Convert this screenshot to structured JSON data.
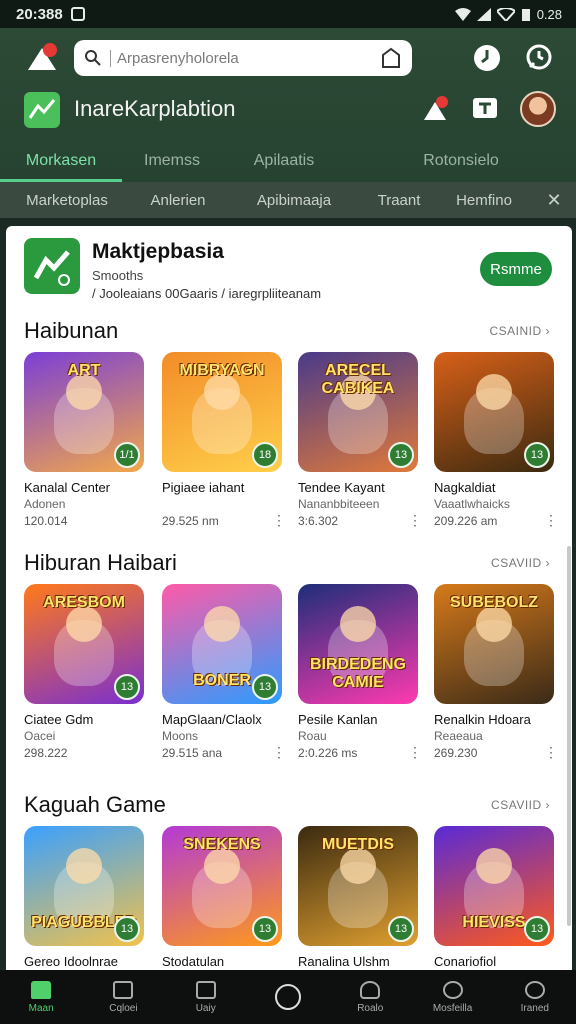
{
  "status": {
    "time": "20:388",
    "battery": "0.28"
  },
  "search": {
    "placeholder": "Arpasrenyholorela"
  },
  "brand": {
    "name": "InareKarplabtion"
  },
  "tabs": [
    "Morkasen",
    "Imemss",
    "Apilaatis",
    "Rotonsielo"
  ],
  "subtabs": [
    "Marketoplas",
    "Anlerien",
    "Apibimaaja",
    "Traant",
    "Hemfino"
  ],
  "featured": {
    "title": "Maktjepbasia",
    "subtitle": "Smooths",
    "meta": "/ Jooleaians 00Gaaris / iaregrpliiteanam",
    "button": "Rsmme"
  },
  "sections": [
    {
      "title": "Haibunan",
      "more": "CSAINID",
      "cards": [
        {
          "name": "Kanalal Center",
          "dev": "Adonen",
          "meta": "120.014",
          "badge": "1/1",
          "art": "ART",
          "colors": [
            "#7b3fd6",
            "#f2a84a"
          ]
        },
        {
          "name": "Pigiaee iahant",
          "dev": "",
          "meta": "29.525 nm",
          "badge": "18",
          "art": "MIBRYAGN",
          "colors": [
            "#f28c28",
            "#ffcf4a"
          ]
        },
        {
          "name": "Tendee Kayant",
          "dev": "Nananbbiteeen",
          "meta": "3:6.302",
          "badge": "13",
          "art": "ARECEL CABIKEA",
          "colors": [
            "#4a3a8a",
            "#e07a3a"
          ]
        },
        {
          "name": "Nagkaldiat",
          "dev": "Vaaatlwhaicks",
          "meta": "209.226 am",
          "badge": "13",
          "art": "",
          "colors": [
            "#d86018",
            "#3b2a10"
          ]
        }
      ]
    },
    {
      "title": "Hiburan Haibari",
      "more": "CSAVIID",
      "cards": [
        {
          "name": "Ciatee Gdm",
          "dev": "Oacei",
          "meta": "298.222",
          "badge": "13",
          "art": "ARESBOM",
          "colors": [
            "#ff7a1a",
            "#7a2fd0"
          ]
        },
        {
          "name": "MapGlaan/Claolx",
          "dev": "Moons",
          "meta": "29.515 ana",
          "badge": "13",
          "art": "BONER",
          "colors": [
            "#ff5aa8",
            "#2b9cff"
          ]
        },
        {
          "name": "Pesile Kanlan",
          "dev": "Roau",
          "meta": "2:0.226 ms",
          "badge": "",
          "art": "BIRDEDENG CAMIE",
          "colors": [
            "#1d2e7a",
            "#ff3ab0"
          ]
        },
        {
          "name": "Renalkin Hdoara",
          "dev": "Reaeaua",
          "meta": "269.230",
          "badge": "",
          "art": "SUBEBOLZ",
          "colors": [
            "#d67a1a",
            "#3a2a18"
          ]
        }
      ]
    },
    {
      "title": "Kaguah Game",
      "more": "CSAVIID",
      "cards": [
        {
          "name": "Gereo Idoolnrae",
          "dev": "",
          "meta": "",
          "badge": "13",
          "art": "PIAGUBBLEB",
          "colors": [
            "#3aa0ff",
            "#f2c24a"
          ]
        },
        {
          "name": "Stodatulan",
          "dev": "",
          "meta": "",
          "badge": "13",
          "art": "SNEKENS",
          "colors": [
            "#b23ad6",
            "#ff9a1a"
          ]
        },
        {
          "name": "Ranalina Ulshm",
          "dev": "",
          "meta": "",
          "badge": "13",
          "art": "MUETDIS",
          "colors": [
            "#3b2a10",
            "#e0a030"
          ]
        },
        {
          "name": "Conariofiol",
          "dev": "",
          "meta": "",
          "badge": "13",
          "art": "HIEVISS",
          "colors": [
            "#5a2ad6",
            "#ff5a1a"
          ]
        }
      ]
    }
  ],
  "nav": [
    "Maan",
    "Cqloei",
    "Uaiy",
    "",
    "Roalo",
    "Mosfeilla",
    "Iraned"
  ]
}
